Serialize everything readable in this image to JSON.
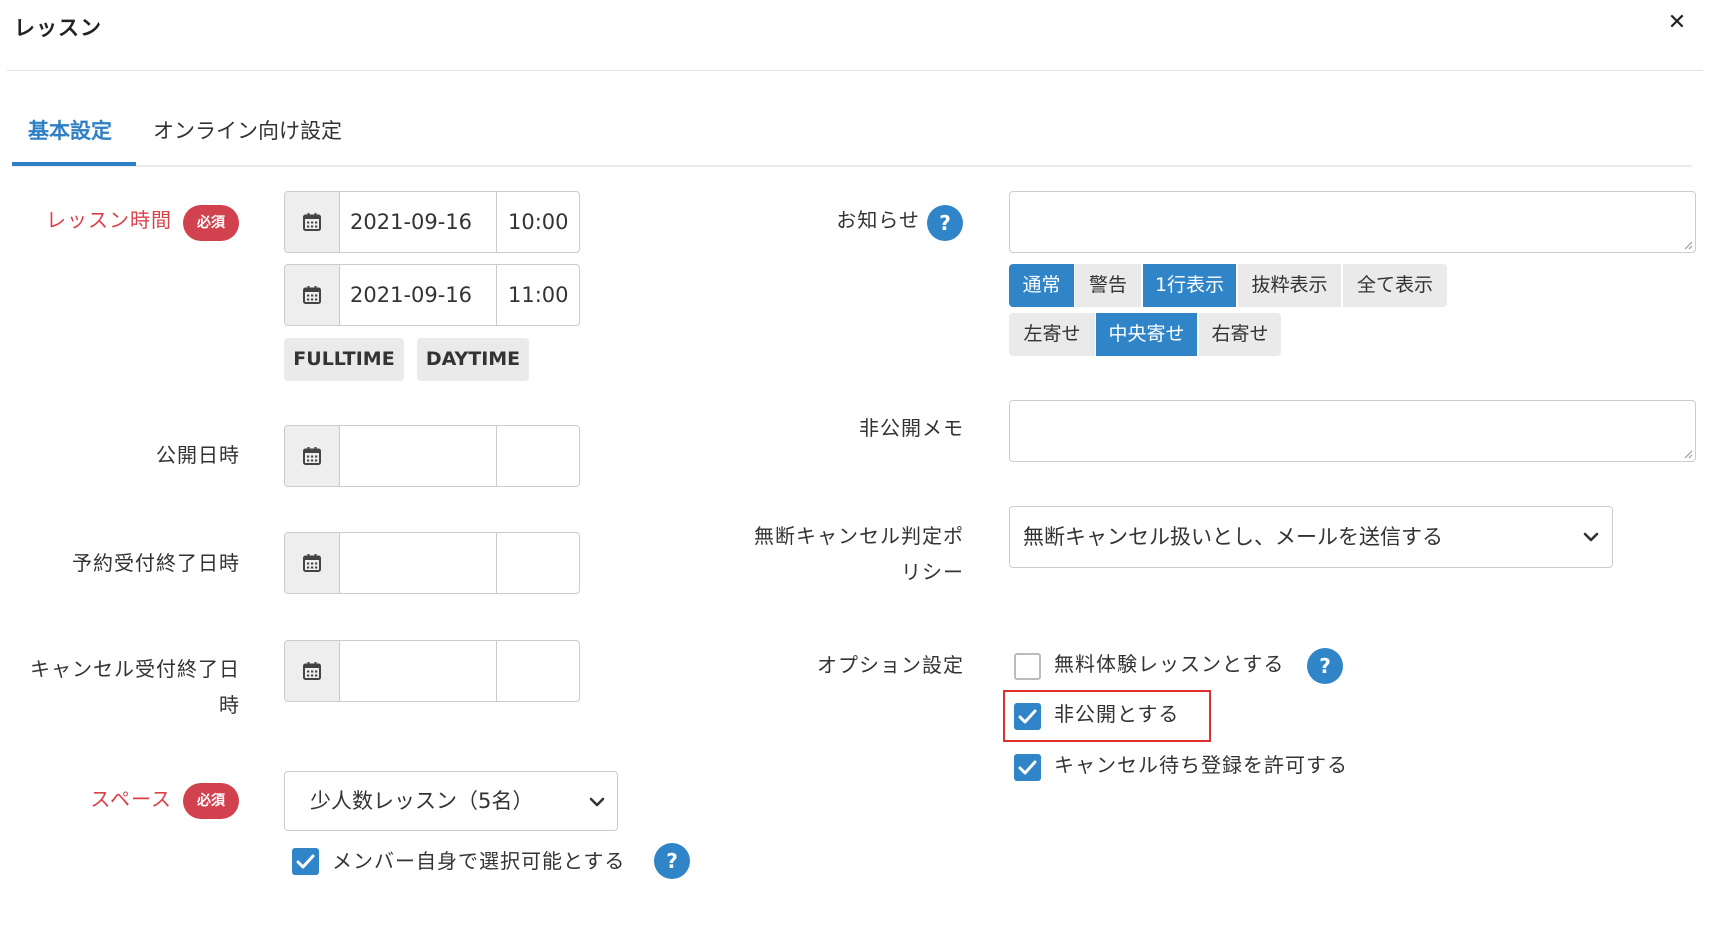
{
  "dialog": {
    "title": "レッスン"
  },
  "tabs": [
    "基本設定",
    "オンライン向け設定"
  ],
  "fields": {
    "lesson_time": {
      "label": "レッスン時間",
      "badge": "必須",
      "start_date": "2021-09-16",
      "start_time": "10:00",
      "end_date": "2021-09-16",
      "end_time": "11:00",
      "buttons": [
        "FULLTIME",
        "DAYTIME"
      ]
    },
    "publish_datetime": {
      "label": "公開日時",
      "date": "",
      "time": ""
    },
    "reservation_end": {
      "label": "予約受付終了日時",
      "date": "",
      "time": ""
    },
    "cancel_end": {
      "label_line1": "キャンセル受付終了日",
      "label_line2": "時",
      "date": "",
      "time": ""
    },
    "space": {
      "label": "スペース",
      "badge": "必須",
      "value": "少人数レッスン（5名）",
      "member_select": {
        "label": "メンバー自身で選択可能とする",
        "checked": true
      }
    },
    "notice": {
      "label": "お知らせ",
      "value": "",
      "type_buttons": [
        {
          "label": "通常",
          "active": true
        },
        {
          "label": "警告",
          "active": false
        },
        {
          "label": "1行表示",
          "active": true
        },
        {
          "label": "抜粋表示",
          "active": false
        },
        {
          "label": "全て表示",
          "active": false
        }
      ],
      "align_buttons": [
        {
          "label": "左寄せ",
          "active": false
        },
        {
          "label": "中央寄せ",
          "active": true
        },
        {
          "label": "右寄せ",
          "active": false
        }
      ]
    },
    "private_memo": {
      "label": "非公開メモ",
      "value": ""
    },
    "no_show_policy": {
      "label_line1": "無断キャンセル判定ポ",
      "label_line2": "リシー",
      "value": "無断キャンセル扱いとし、メールを送信する"
    },
    "options": {
      "label": "オプション設定",
      "items": [
        {
          "label": "無料体験レッスンとする",
          "checked": false
        },
        {
          "label": "非公開とする",
          "checked": true
        },
        {
          "label": "キャンセル待ち登録を許可する",
          "checked": true
        }
      ]
    }
  },
  "icons": {
    "calendar": "calendar-icon",
    "help": "?",
    "close": "×",
    "chevron": "chevron-down-icon"
  },
  "colors": {
    "accent": "#2f85c8",
    "required": "#d2414e",
    "highlight": "#e0312c"
  }
}
